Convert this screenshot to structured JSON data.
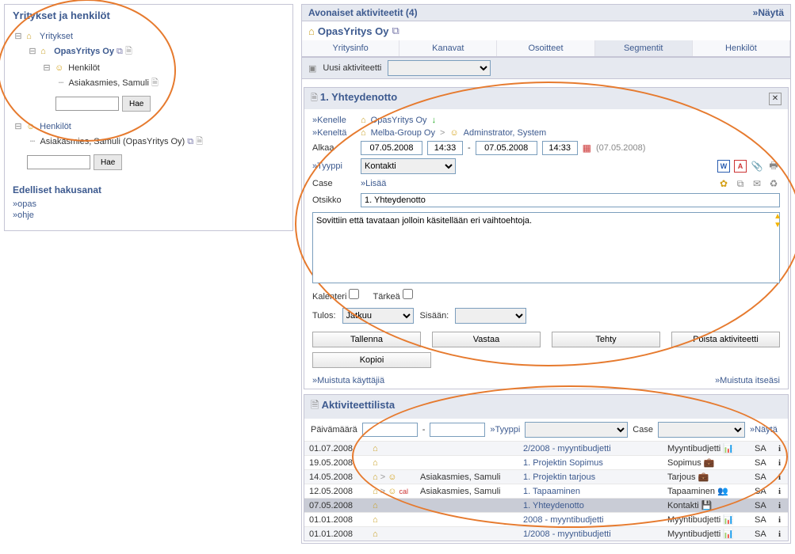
{
  "leftPanel": {
    "title": "Yritykset ja henkilöt",
    "tree": {
      "companiesRoot": "Yritykset",
      "company": "OpasYritys Oy",
      "personsNode": "Henkilöt",
      "person": "Asiakasmies, Samuli",
      "searchBtn": "Hae",
      "personsRoot": "Henkilöt",
      "personFull": "Asiakasmies, Samuli (OpasYritys Oy)"
    },
    "prevSearchesTitle": "Edelliset hakusanat",
    "prevSearches": [
      "»opas",
      "»ohje"
    ]
  },
  "header": {
    "openActivities": "Avonaiset aktiviteetit (4)",
    "show": "»Näytä",
    "company": "OpasYritys Oy"
  },
  "tabs": [
    "Yritysinfo",
    "Kanavat",
    "Osoitteet",
    "Segmentit",
    "Henkilöt"
  ],
  "newActivity": {
    "label": "Uusi aktiviteetti"
  },
  "activity": {
    "title": "1. Yhteydenotto",
    "kenelleLabel": "»Kenelle",
    "kenelleValue": "OpasYritys Oy",
    "keneltaLabel": "»Keneltä",
    "keneltaOrg": "Melba-Group Oy",
    "keneltaPerson": "Adminstrator, System",
    "alkaaLabel": "Alkaa",
    "startDate": "07.05.2008",
    "startTime": "14:33",
    "endDate": "07.05.2008",
    "endTime": "14:33",
    "extraDate": "(07.05.2008)",
    "tyyppiLabel": "»Tyyppi",
    "tyyppiValue": "Kontakti",
    "caseLabel": "Case",
    "caseAdd": "»Lisää",
    "otsikkoLabel": "Otsikko",
    "otsikkoValue": "1. Yhteydenotto",
    "notes": "Sovittiin että tavataan jolloin käsitellään eri vaihtoehtoja.",
    "kalenteri": "Kalenteri",
    "tarkea": "Tärkeä",
    "tulosLabel": "Tulos:",
    "tulosValue": "Jatkuu",
    "sisaanLabel": "Sisään:",
    "buttons": {
      "tallenna": "Tallenna",
      "vastaa": "Vastaa",
      "tehty": "Tehty",
      "poista": "Poista aktiviteetti",
      "kopioi": "Kopioi"
    },
    "remindUsers": "»Muistuta käyttäjiä",
    "remindSelf": "»Muistuta itseäsi"
  },
  "activityList": {
    "title": "Aktiviteettilista",
    "dateLabel": "Päivämäärä",
    "tyyppiLabel": "»Tyyppi",
    "caseLabel": "Case",
    "show": "»Näytä",
    "rows": [
      {
        "date": "01.07.2008",
        "who": "",
        "desc": "2/2008 - myyntibudjetti",
        "type": "Myyntibudjetti",
        "user": "SA",
        "i": "i"
      },
      {
        "date": "19.05.2008",
        "who": "",
        "desc": "1. Projektin Sopimus",
        "type": "Sopimus",
        "user": "SA",
        "i": "i"
      },
      {
        "date": "14.05.2008",
        "who": "Asiakasmies, Samuli",
        "desc": "1. Projektin tarjous",
        "type": "Tarjous",
        "user": "SA",
        "i": "i"
      },
      {
        "date": "12.05.2008",
        "who": "Asiakasmies, Samuli",
        "desc": "1. Tapaaminen",
        "type": "Tapaaminen",
        "user": "SA",
        "i": "i"
      },
      {
        "date": "07.05.2008",
        "who": "",
        "desc": "1. Yhteydenotto",
        "type": "Kontakti",
        "user": "SA",
        "i": "i"
      },
      {
        "date": "01.01.2008",
        "who": "",
        "desc": "2008 - myyntibudjetti",
        "type": "Myyntibudjetti",
        "user": "SA",
        "i": "i"
      },
      {
        "date": "01.01.2008",
        "who": "",
        "desc": "1/2008 - myyntibudjetti",
        "type": "Myyntibudjetti",
        "user": "SA",
        "i": "i"
      }
    ]
  }
}
